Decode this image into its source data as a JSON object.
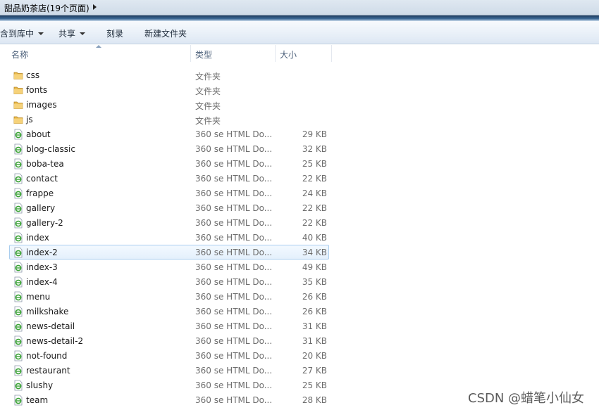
{
  "address": {
    "path": "甜品奶茶店(19个页面)"
  },
  "toolbar": {
    "include_library_label": "包含到库中",
    "share_label": "共享",
    "burn_label": "刻录",
    "new_folder_label": "新建文件夹"
  },
  "columns": {
    "name": "名称",
    "type": "类型",
    "size": "大小"
  },
  "files": [
    {
      "name": "css",
      "type": "文件夹",
      "size": "",
      "icon": "folder-icon"
    },
    {
      "name": "fonts",
      "type": "文件夹",
      "size": "",
      "icon": "folder-icon"
    },
    {
      "name": "images",
      "type": "文件夹",
      "size": "",
      "icon": "folder-icon"
    },
    {
      "name": "js",
      "type": "文件夹",
      "size": "",
      "icon": "folder-icon"
    },
    {
      "name": "about",
      "type": "360 se HTML Do...",
      "size": "29 KB",
      "icon": "html-file-icon"
    },
    {
      "name": "blog-classic",
      "type": "360 se HTML Do...",
      "size": "32 KB",
      "icon": "html-file-icon"
    },
    {
      "name": "boba-tea",
      "type": "360 se HTML Do...",
      "size": "25 KB",
      "icon": "html-file-icon"
    },
    {
      "name": "contact",
      "type": "360 se HTML Do...",
      "size": "22 KB",
      "icon": "html-file-icon"
    },
    {
      "name": "frappe",
      "type": "360 se HTML Do...",
      "size": "24 KB",
      "icon": "html-file-icon"
    },
    {
      "name": "gallery",
      "type": "360 se HTML Do...",
      "size": "22 KB",
      "icon": "html-file-icon"
    },
    {
      "name": "gallery-2",
      "type": "360 se HTML Do...",
      "size": "22 KB",
      "icon": "html-file-icon"
    },
    {
      "name": "index",
      "type": "360 se HTML Do...",
      "size": "40 KB",
      "icon": "html-file-icon"
    },
    {
      "name": "index-2",
      "type": "360 se HTML Do...",
      "size": "34 KB",
      "icon": "html-file-icon",
      "selected": true
    },
    {
      "name": "index-3",
      "type": "360 se HTML Do...",
      "size": "49 KB",
      "icon": "html-file-icon"
    },
    {
      "name": "index-4",
      "type": "360 se HTML Do...",
      "size": "35 KB",
      "icon": "html-file-icon"
    },
    {
      "name": "menu",
      "type": "360 se HTML Do...",
      "size": "26 KB",
      "icon": "html-file-icon"
    },
    {
      "name": "milkshake",
      "type": "360 se HTML Do...",
      "size": "26 KB",
      "icon": "html-file-icon"
    },
    {
      "name": "news-detail",
      "type": "360 se HTML Do...",
      "size": "31 KB",
      "icon": "html-file-icon"
    },
    {
      "name": "news-detail-2",
      "type": "360 se HTML Do...",
      "size": "31 KB",
      "icon": "html-file-icon"
    },
    {
      "name": "not-found",
      "type": "360 se HTML Do...",
      "size": "20 KB",
      "icon": "html-file-icon"
    },
    {
      "name": "restaurant",
      "type": "360 se HTML Do...",
      "size": "27 KB",
      "icon": "html-file-icon"
    },
    {
      "name": "slushy",
      "type": "360 se HTML Do...",
      "size": "25 KB",
      "icon": "html-file-icon"
    },
    {
      "name": "team",
      "type": "360 se HTML Do...",
      "size": "28 KB",
      "icon": "html-file-icon"
    }
  ],
  "watermark": "CSDN @蜡笔小仙女",
  "colors": {
    "selection": "#e4f0fc",
    "selection_border": "#a9cdee",
    "folder": "#e9b94a",
    "html_icon": "#3aa335"
  }
}
